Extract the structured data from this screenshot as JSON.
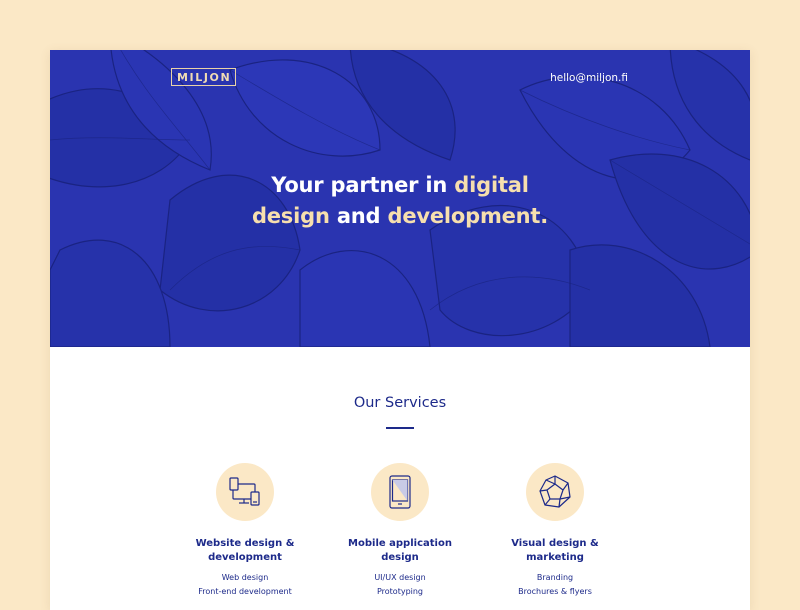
{
  "brand": {
    "logo_text": "MILJON"
  },
  "header": {
    "email": "hello@miljon.fi"
  },
  "hero": {
    "line1_plain": "Your partner in ",
    "line1_highlight": "digital",
    "line2_highlight_a": "design",
    "line2_plain": " and ",
    "line2_highlight_b": "development."
  },
  "services": {
    "heading": "Our Services",
    "items": [
      {
        "icon": "devices-icon",
        "title_line1": "Website design &",
        "title_line2": "development",
        "subitems": [
          "Web design",
          "Front-end development"
        ]
      },
      {
        "icon": "tablet-icon",
        "title_line1": "Mobile application",
        "title_line2": "design",
        "subitems": [
          "UI/UX design",
          "Prototyping"
        ]
      },
      {
        "icon": "polyhedron-icon",
        "title_line1": "Visual design &",
        "title_line2": "marketing",
        "subitems": [
          "Branding",
          "Brochures & flyers"
        ]
      }
    ]
  },
  "colors": {
    "background": "#fbe8c6",
    "hero": "#2a34b0",
    "accent": "#f6dfae",
    "navy": "#1d2a8a"
  }
}
